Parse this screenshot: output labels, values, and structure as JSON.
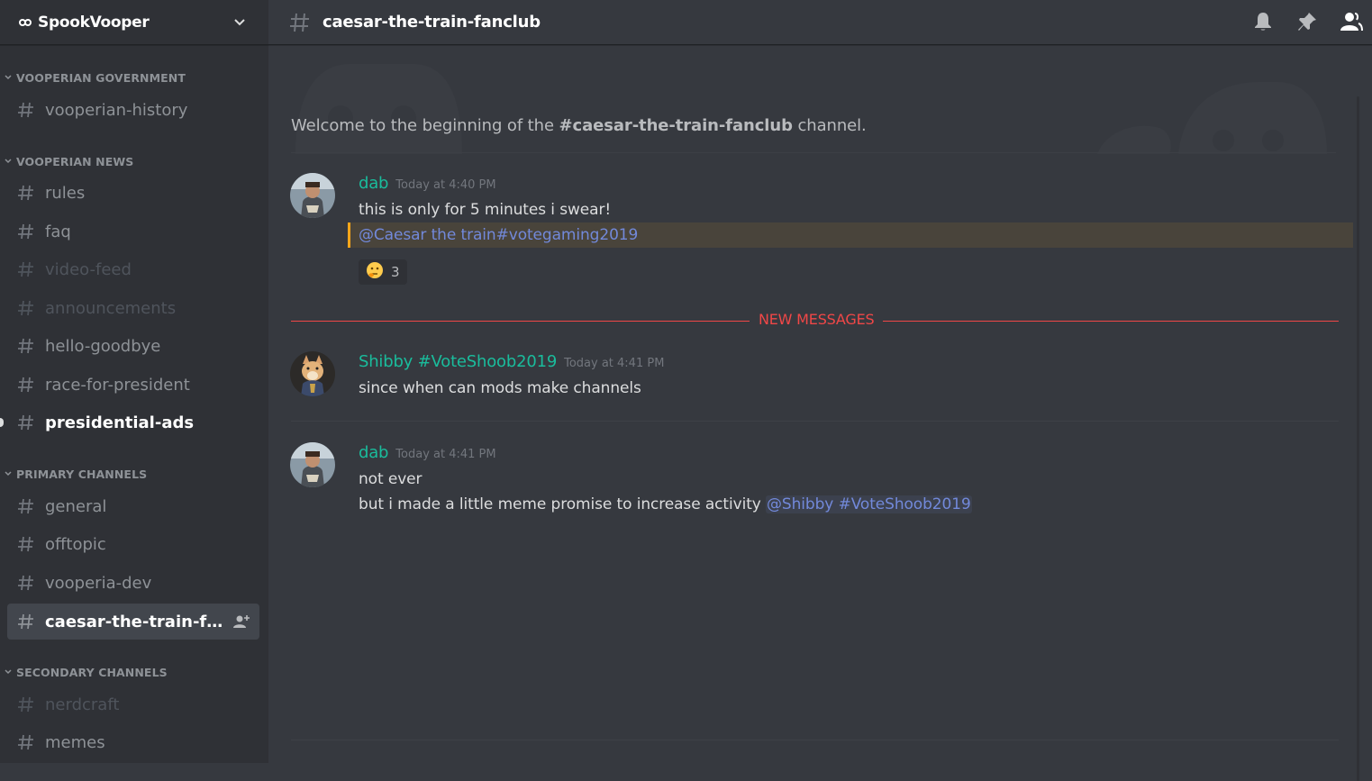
{
  "server": {
    "name": "SpookVooper"
  },
  "sidebar": {
    "categories": [
      {
        "name": "VOOPERIAN GOVERNMENT"
      },
      {
        "name": "VOOPERIAN NEWS"
      },
      {
        "name": "PRIMARY CHANNELS"
      },
      {
        "name": "SECONDARY CHANNELS"
      }
    ],
    "channels": [
      {
        "label": "vooperian-history",
        "state": "normal"
      },
      {
        "label": "rules",
        "state": "normal"
      },
      {
        "label": "faq",
        "state": "normal"
      },
      {
        "label": "video-feed",
        "state": "muted"
      },
      {
        "label": "announcements",
        "state": "muted"
      },
      {
        "label": "hello-goodbye",
        "state": "normal"
      },
      {
        "label": "race-for-president",
        "state": "normal"
      },
      {
        "label": "presidential-ads",
        "state": "unread"
      },
      {
        "label": "general",
        "state": "normal"
      },
      {
        "label": "offtopic",
        "state": "normal"
      },
      {
        "label": "vooperia-dev",
        "state": "normal"
      },
      {
        "label": "caesar-the-train-fancl...",
        "state": "active"
      },
      {
        "label": "nerdcraft",
        "state": "muted"
      },
      {
        "label": "memes",
        "state": "normal"
      }
    ]
  },
  "header": {
    "channel_name": "caesar-the-train-fanclub",
    "icons": [
      "bell-icon",
      "pin-icon",
      "members-icon"
    ]
  },
  "chat": {
    "welcome": {
      "prefix": "Welcome to the beginning of the ",
      "channel": "#caesar-the-train-fanclub",
      "suffix": " channel."
    },
    "messages": [
      {
        "author": "dab",
        "author_color": "#1abc9c",
        "timestamp": "Today at 4:40 PM",
        "lines": [
          "this is only for 5 minutes i swear!"
        ],
        "mention_line": "@Caesar the train#votegaming2019",
        "reaction": {
          "emoji": "thinking-face-icon",
          "count": "3"
        }
      },
      {
        "author": "Shibby #VoteShoob2019",
        "author_color": "#1abc9c",
        "timestamp": "Today at 4:41 PM",
        "lines": [
          "since when can mods make channels"
        ]
      },
      {
        "author": "dab",
        "author_color": "#1abc9c",
        "timestamp": "Today at 4:41 PM",
        "lines": [
          "not ever",
          "but i made a little meme promise to increase activity "
        ],
        "mention": "@Shibby #VoteShoob2019"
      }
    ],
    "new_messages_label": "NEW MESSAGES"
  },
  "colors": {
    "background": "#36393f",
    "sidebar": "#2f3136",
    "accent_mention": "#7289da",
    "new_messages": "#f04747",
    "author": "#1abc9c",
    "highlight_bar": "#faa61a"
  }
}
